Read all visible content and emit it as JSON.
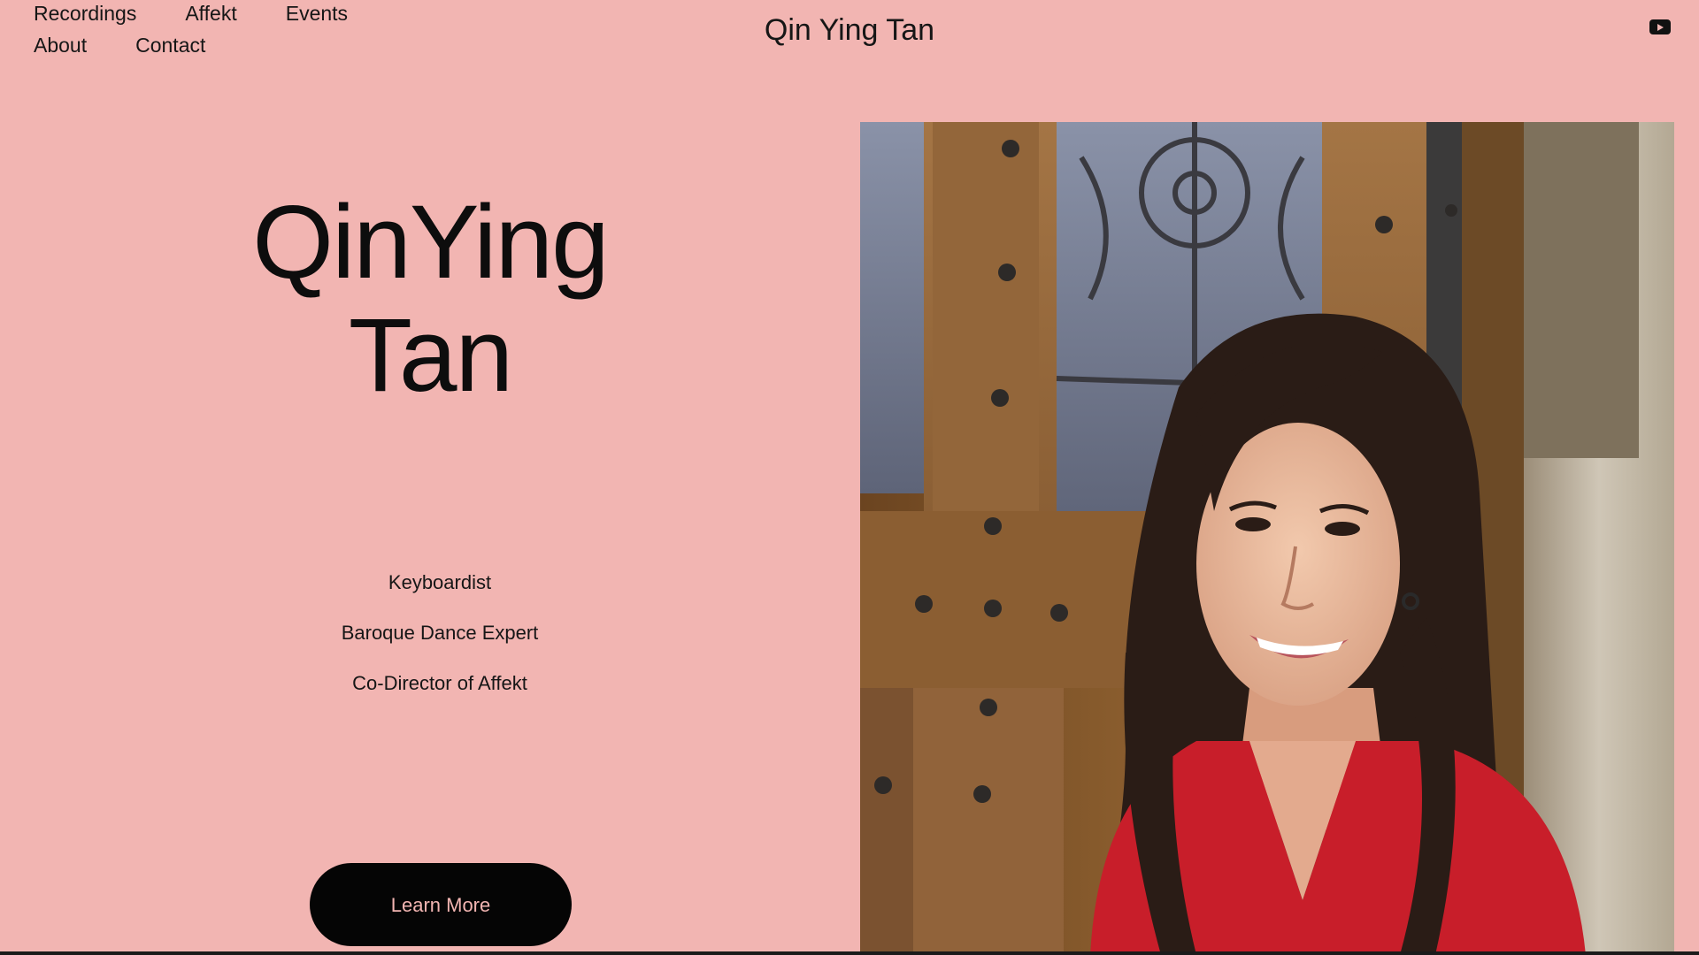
{
  "nav": {
    "items": [
      {
        "label": "Recordings"
      },
      {
        "label": "Affekt"
      },
      {
        "label": "Events"
      },
      {
        "label": "About"
      },
      {
        "label": "Contact"
      }
    ]
  },
  "header": {
    "site_title": "Qin Ying Tan",
    "social_icon": "youtube-icon"
  },
  "hero": {
    "title_line1": "QinYing",
    "title_line2": "Tan",
    "roles": [
      "Keyboardist",
      "Baroque Dance Expert",
      "Co-Director of Affekt"
    ],
    "cta_label": "Learn More"
  },
  "colors": {
    "background": "#f2b5b2",
    "text": "#111111",
    "button_bg": "#050505",
    "button_text": "#f2b5b2"
  }
}
